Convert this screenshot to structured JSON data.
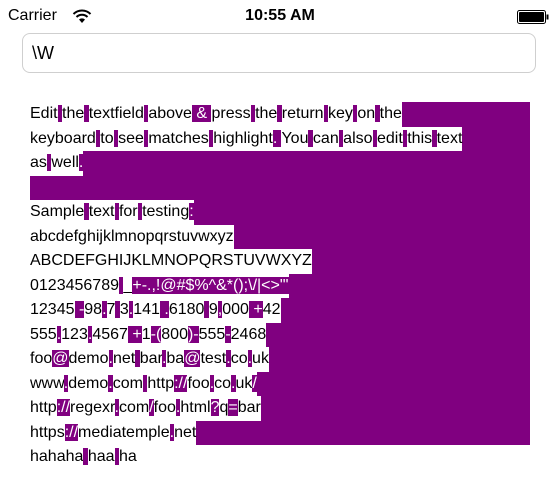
{
  "status_bar": {
    "carrier": "Carrier",
    "time": "10:55 AM",
    "signal_icon": "wifi-icon",
    "battery_icon": "battery-icon"
  },
  "search": {
    "value": "\\W",
    "placeholder": ""
  },
  "highlight_color": "#800080",
  "text_lines": [
    "Edit the textfield above & press the return key on the",
    "keyboard to see matches highlight. You can also edit this text",
    "as well.",
    "",
    "Sample text for testing:",
    "abcdefghijklmnopqrstuvwxyz",
    "ABCDEFGHIJKLMNOPQRSTUVWXYZ",
    "0123456789 _+-.,!@#$%^&*();\\/|<>\"'",
    "12345 -98.7 3.141 .6180 9,000 +42",
    "555.123.4567 +1-(800)-555-2468",
    "foo@demo.net bar.ba@test.co.uk",
    "www.demo.com http://foo.co.uk/",
    "http://regexr.com/foo.html?q=bar",
    "https://mediatemple.net",
    "hahaha haa ha"
  ]
}
